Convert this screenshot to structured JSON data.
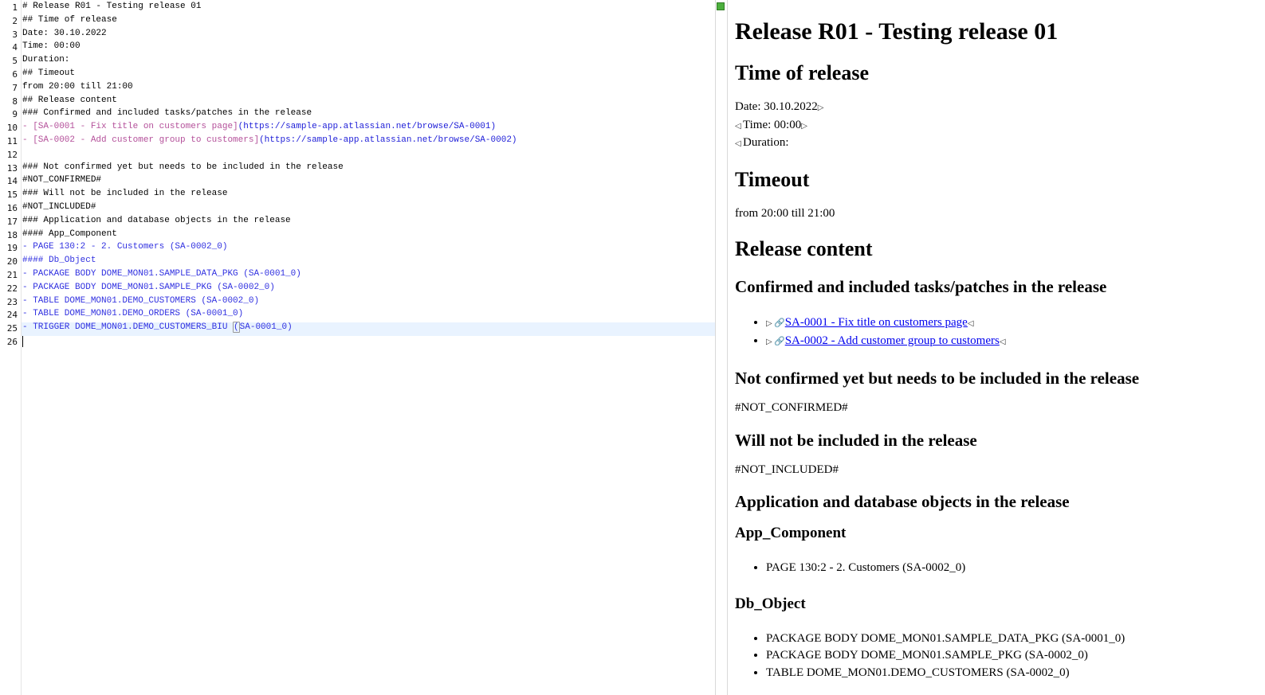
{
  "editor": {
    "lines": [
      {
        "n": "1",
        "text": "# Release R01 - Testing release 01"
      },
      {
        "n": "2",
        "text": "## Time of release"
      },
      {
        "n": "3",
        "text": "Date: 30.10.2022"
      },
      {
        "n": "4",
        "text": "Time: 00:00"
      },
      {
        "n": "5",
        "text": "Duration:"
      },
      {
        "n": "6",
        "text": "## Timeout"
      },
      {
        "n": "7",
        "text": "from 20:00 till 21:00"
      },
      {
        "n": "8",
        "text": "## Release content"
      },
      {
        "n": "9",
        "text": "### Confirmed and included tasks/patches in the release"
      },
      {
        "n": "10",
        "text": "- [SA-0001 - Fix title on customers page]",
        "url": "(https://sample-app.atlassian.net/browse/SA-0001)"
      },
      {
        "n": "11",
        "text": "- [SA-0002 - Add customer group to customers]",
        "url": "(https://sample-app.atlassian.net/browse/SA-0002)"
      },
      {
        "n": "12",
        "text": ""
      },
      {
        "n": "13",
        "text": "### Not confirmed yet but needs to be included in the release"
      },
      {
        "n": "14",
        "text": "#NOT_CONFIRMED#"
      },
      {
        "n": "15",
        "text": "### Will not be included in the release"
      },
      {
        "n": "16",
        "text": "#NOT_INCLUDED#"
      },
      {
        "n": "17",
        "text": "### Application and database objects in the release"
      },
      {
        "n": "18",
        "text": "#### App_Component"
      },
      {
        "n": "19",
        "text": "- PAGE 130:2 - 2. Customers (SA-0002_0)"
      },
      {
        "n": "20",
        "text": "#### Db_Object"
      },
      {
        "n": "21",
        "text": "- PACKAGE BODY DOME_MON01.SAMPLE_DATA_PKG (SA-0001_0)"
      },
      {
        "n": "22",
        "text": "- PACKAGE BODY DOME_MON01.SAMPLE_PKG (SA-0002_0)"
      },
      {
        "n": "23",
        "text": "- TABLE DOME_MON01.DEMO_CUSTOMERS (SA-0002_0)"
      },
      {
        "n": "24",
        "text": "- TABLE DOME_MON01.DEMO_ORDERS (SA-0001_0)"
      },
      {
        "n": "25",
        "text_before": "- TRIGGER DOME_MON01.DEMO_CUSTOMERS_BIU ",
        "bracket": "(",
        "text_after": "SA-0001_0)"
      },
      {
        "n": "26",
        "text": ""
      }
    ]
  },
  "preview": {
    "h1": "Release R01 - Testing release 01",
    "time_heading": "Time of release",
    "date": "Date: 30.10.2022",
    "time": "Time: 00:00",
    "duration": "Duration:",
    "timeout_heading": "Timeout",
    "timeout_text": "from 20:00 till 21:00",
    "content_heading": "Release content",
    "confirmed_heading": "Confirmed and included tasks/patches in the release",
    "links": [
      "SA-0001 - Fix title on customers page",
      "SA-0002 - Add customer group to customers"
    ],
    "not_confirmed_heading": "Not confirmed yet but needs to be included in the release",
    "not_confirmed_text": "#NOT_CONFIRMED#",
    "not_included_heading": "Will not be included in the release",
    "not_included_text": "#NOT_INCLUDED#",
    "objects_heading": "Application and database objects in the release",
    "app_component_heading": "App_Component",
    "app_items": [
      "PAGE 130:2 - 2. Customers (SA-0002_0)"
    ],
    "db_object_heading": "Db_Object",
    "db_items": [
      "PACKAGE BODY DOME_MON01.SAMPLE_DATA_PKG (SA-0001_0)",
      "PACKAGE BODY DOME_MON01.SAMPLE_PKG (SA-0002_0)",
      "TABLE DOME_MON01.DEMO_CUSTOMERS (SA-0002_0)"
    ]
  },
  "colors": {
    "list_item": "#3030e0",
    "link_text": "#b4509a",
    "url": "#2020d8",
    "marker": "#4caf3d"
  }
}
